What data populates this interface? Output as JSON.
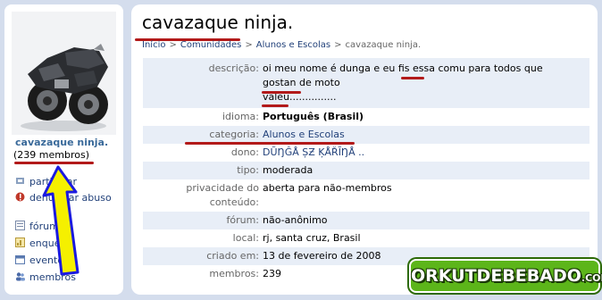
{
  "sidebar": {
    "community_name": "cavazaque ninja.",
    "member_count": "(239 membros)",
    "actions": [
      {
        "label": "participar",
        "icon": "join-icon"
      },
      {
        "label": "denunciar abuso",
        "icon": "report-abuse-icon"
      }
    ],
    "nav": [
      {
        "label": "fórum",
        "icon": "forum-icon"
      },
      {
        "label": "enquetes",
        "icon": "poll-icon"
      },
      {
        "label": "eventos",
        "icon": "calendar-icon"
      },
      {
        "label": "membros",
        "icon": "members-icon"
      }
    ]
  },
  "main": {
    "title": "cavazaque ninja.",
    "breadcrumb": [
      "Início",
      "Comunidades",
      "Alunos e Escolas",
      "cavazaque ninja."
    ],
    "info": [
      {
        "label": "descrição:",
        "value_lines": [
          "oi meu nome é dunga e eu fis essa comu para todos que",
          "gostan de moto",
          "valeu..............."
        ]
      },
      {
        "label": "idioma:",
        "value": "Português (Brasil)"
      },
      {
        "label": "categoria:",
        "value": "Alunos e Escolas"
      },
      {
        "label": "dono:",
        "value": "DŨŊĜÅ ȘƵ ĶÅŘĨŊÅ .."
      },
      {
        "label": "tipo:",
        "value": "moderada"
      },
      {
        "label_lines": [
          "privacidade do",
          "conteúdo:"
        ],
        "value": "aberta para não-membros"
      },
      {
        "label": "fórum:",
        "value": "não-anônimo"
      },
      {
        "label": "local:",
        "value": "rj, santa cruz, Brasil"
      },
      {
        "label": "criado em:",
        "value": "13 de fevereiro de 2008"
      },
      {
        "label": "membros:",
        "value": "239"
      }
    ]
  },
  "watermark": {
    "text": "ORKUTDEBEBADO",
    "suffix": ".COM"
  },
  "colors": {
    "annotation_red": "#b21a1a",
    "arrow_yellow": "#f5f000",
    "arrow_blue": "#1a1ae0",
    "link": "#22417a",
    "logo_green": "#5cb51a"
  }
}
